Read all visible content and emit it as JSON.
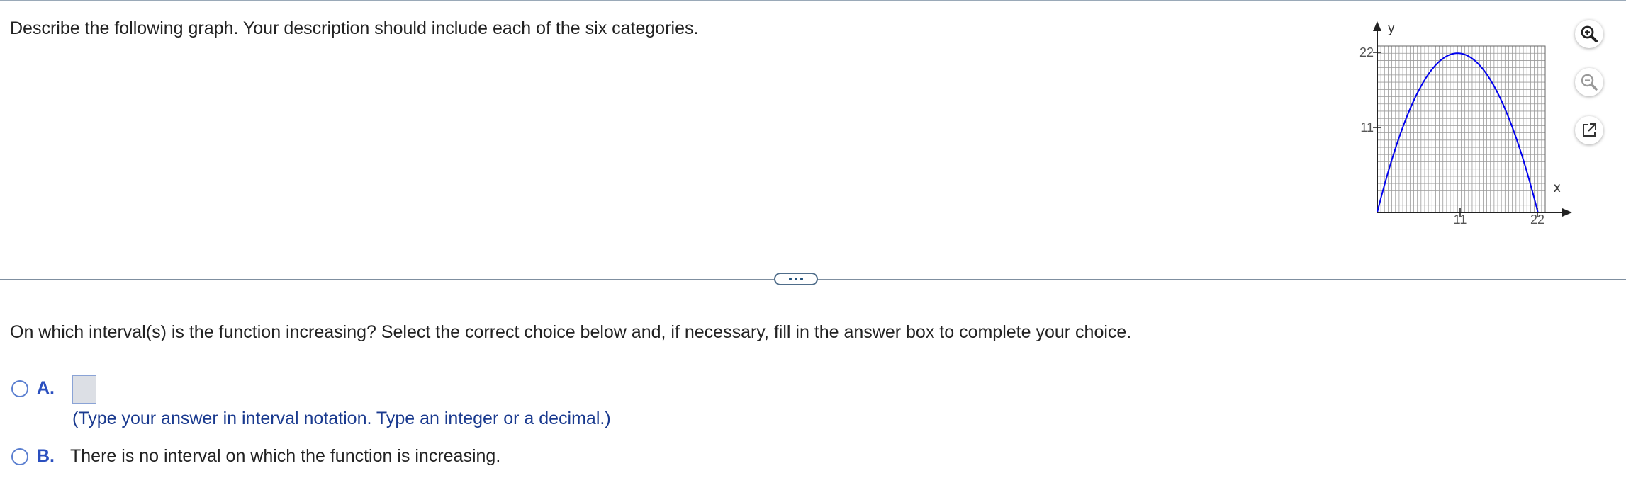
{
  "question": "Describe the following graph. Your description should include each of the six categories.",
  "graph": {
    "y_label": "y",
    "x_label": "x",
    "x_ticks": [
      "11",
      "22"
    ],
    "y_ticks": [
      "22",
      "11"
    ],
    "curve_color": "#0000ee",
    "grid_color": "#9a9a9a",
    "curve_points": [
      [
        0,
        0
      ],
      [
        11,
        22
      ],
      [
        22,
        0
      ]
    ],
    "x_range": [
      0,
      23
    ],
    "y_range": [
      0,
      23
    ]
  },
  "tools": {
    "zoom_in_icon": "zoom-in-icon",
    "zoom_out_icon": "zoom-out-icon",
    "popout_icon": "popout-icon"
  },
  "subquestion": "On which interval(s) is the function increasing? Select the correct choice below and, if necessary, fill in the answer box to complete your choice.",
  "choices": {
    "a": {
      "letter": "A.",
      "answer_value": "",
      "hint": "(Type your answer in interval notation. Type an integer or a decimal.)"
    },
    "b": {
      "letter": "B.",
      "text": "There is no interval on which the function is increasing."
    }
  },
  "colors": {
    "accent": "#2a4fbf",
    "hint": "#1a3a8f"
  }
}
